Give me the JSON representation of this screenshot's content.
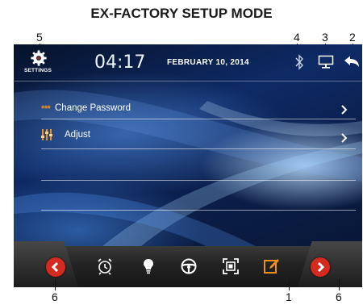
{
  "doc_title": "EX-FACTORY SETUP MODE",
  "callouts": {
    "n5": "5",
    "n4": "4",
    "n3": "3",
    "n2": "2",
    "n6_left": "6",
    "n1": "1",
    "n6_right": "6"
  },
  "header": {
    "settings_label": "SETTINGS",
    "time": "04:17",
    "date": "FEBRUARY 10, 2014"
  },
  "menu": [
    {
      "label": "Change Password",
      "icon": "asterisk-password-icon",
      "prefix": "***"
    },
    {
      "label": "Adjust",
      "icon": "equalizer-sliders-icon"
    }
  ],
  "dock": {
    "icons": [
      "alarm-clock-icon",
      "light-bulb-icon",
      "steering-wheel-icon",
      "screen-fit-icon",
      "edit-note-icon"
    ],
    "active": "edit-note-icon",
    "accent_color": "#f0901a",
    "arrow_color": "#d42a20"
  }
}
